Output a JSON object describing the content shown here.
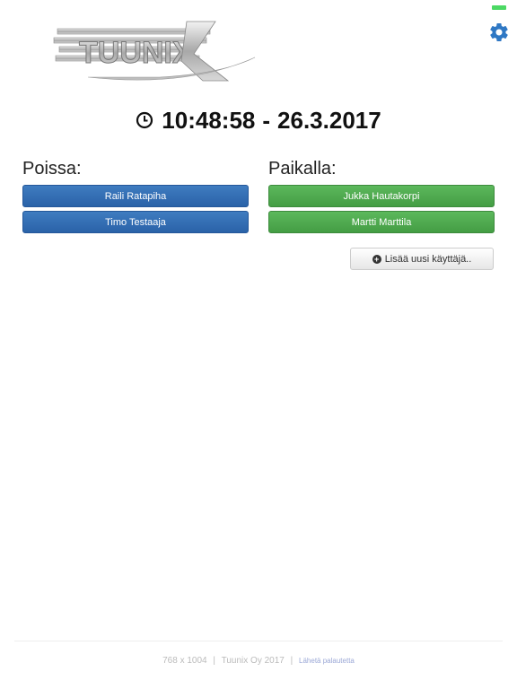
{
  "header": {
    "logo_text": "TUUNIX",
    "settings_icon": "gear-icon",
    "accent": "#2f78c4"
  },
  "clock": {
    "time": "10:48:58",
    "separator": "-",
    "date": "26.3.2017",
    "icon": "clock-icon"
  },
  "absent": {
    "title": "Poissa:",
    "people": [
      "Raili Ratapiha",
      "Timo Testaaja"
    ],
    "color": "#2a62a8"
  },
  "present": {
    "title": "Paikalla:",
    "people": [
      "Jukka Hautakorpi",
      "Martti Marttila"
    ],
    "color": "#4cae4c"
  },
  "add_user": {
    "label": "Lisää uusi käyttäjä..",
    "icon": "plus-circle-icon"
  },
  "footer": {
    "resolution": "768 x 1004",
    "company": "Tuunix Oy",
    "year": "2017",
    "feedback": "Lähetä palautetta"
  }
}
